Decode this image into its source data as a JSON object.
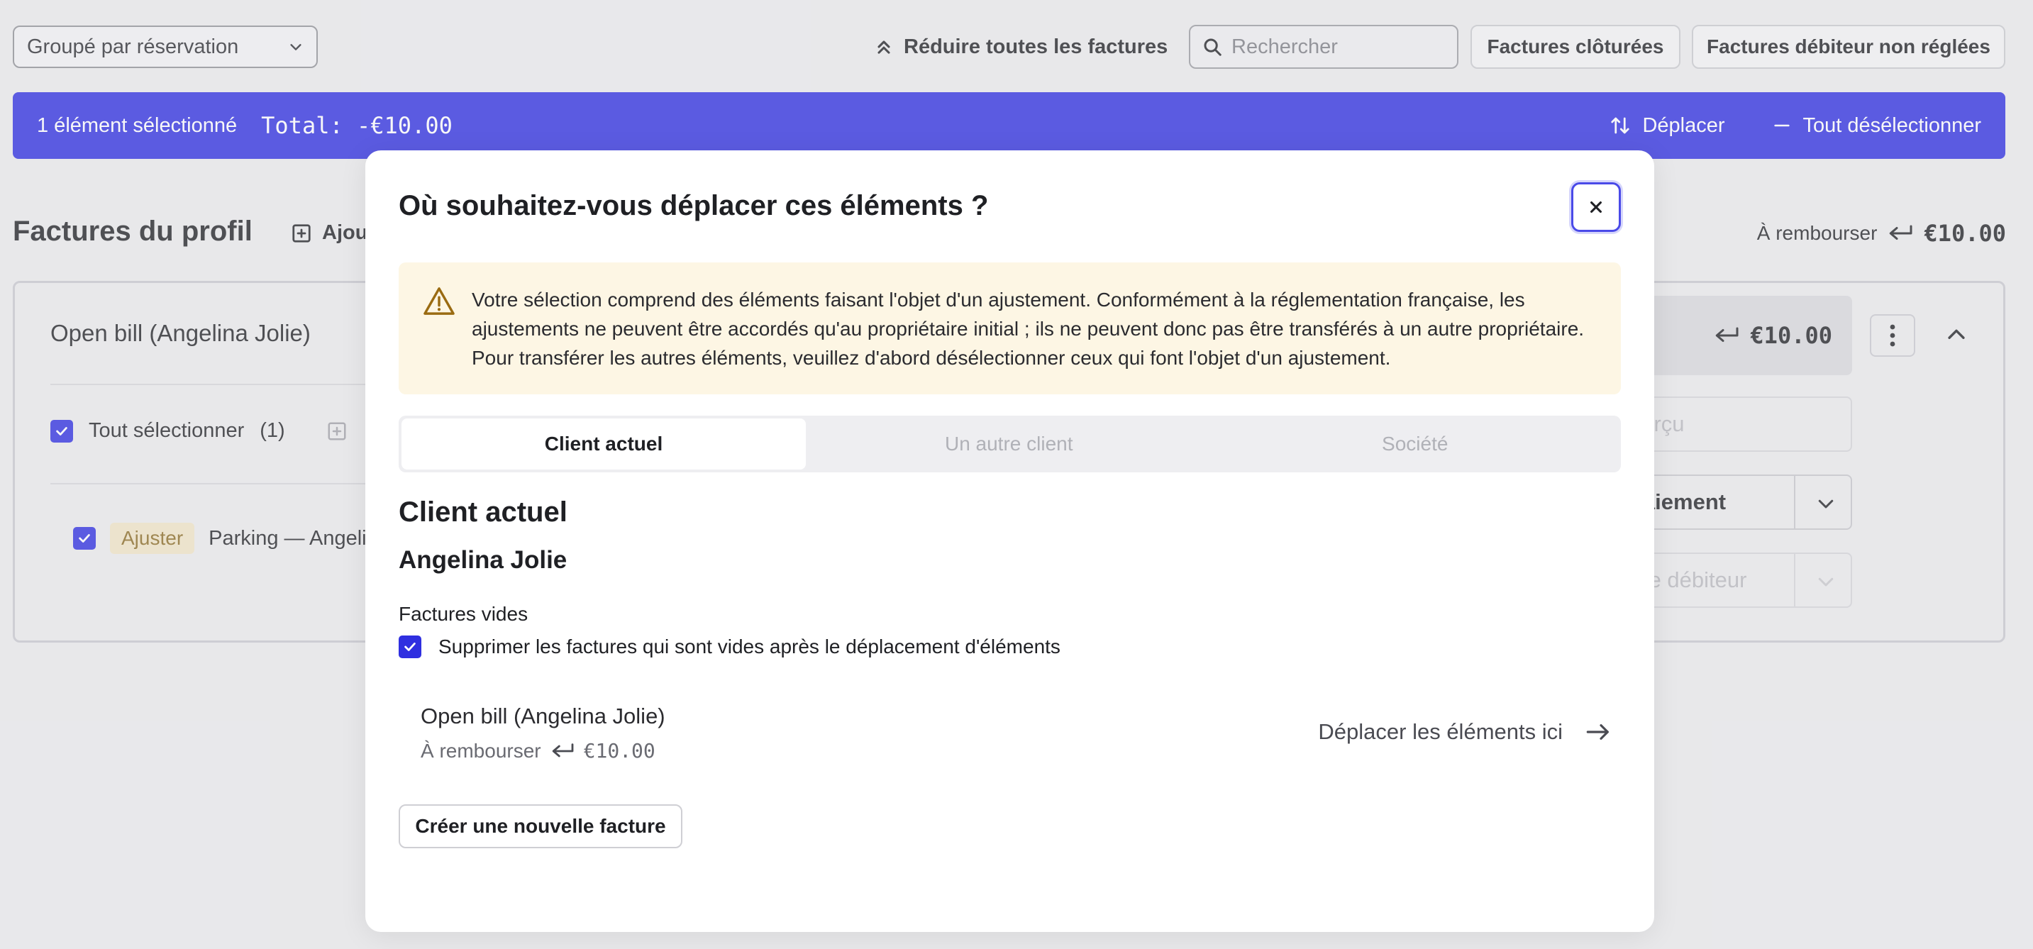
{
  "toolbar": {
    "group_select_value": "Groupé par réservation",
    "collapse_all_label": "Réduire toutes les factures",
    "search_placeholder": "Rechercher",
    "closed_bills_label": "Factures clôturées",
    "unpaid_debtor_label": "Factures débiteur non réglées"
  },
  "selection_bar": {
    "count_text": "1 élément sélectionné",
    "total_text": "Total: -€10.00",
    "move_label": "Déplacer",
    "deselect_all_label": "Tout désélectionner",
    "color": "#2f2fe0"
  },
  "profile": {
    "title": "Factures du profil",
    "add_label": "Ajou",
    "refund_label": "À rembourser",
    "refund_amount": "€10.00"
  },
  "bill_card": {
    "name": "Open bill (Angelina Jolie)",
    "select_all_label": "Tout sélectionner",
    "select_all_count": "(1)",
    "item_tag": "Ajuster",
    "item_label": "Parking — Angeli",
    "refund_amount": "€10.00",
    "preview_label": "perçu",
    "payment_label": "paiement",
    "debtor_label": "ure débiteur"
  },
  "modal": {
    "title": "Où souhaitez-vous déplacer ces éléments ?",
    "warning_text": "Votre sélection comprend des éléments faisant l'objet d'un ajustement. Conformément à la réglementation française, les ajustements ne peuvent être accordés qu'au propriétaire initial ; ils ne peuvent donc pas être transférés à un autre propriétaire. Pour transférer les autres éléments, veuillez d'abord désélectionner ceux qui font l'objet d'un ajustement.",
    "tabs": [
      {
        "label": "Client actuel",
        "active": true
      },
      {
        "label": "Un autre client",
        "active": false
      },
      {
        "label": "Société",
        "active": false
      }
    ],
    "section_title": "Client actuel",
    "client_name": "Angelina Jolie",
    "empty_bills_label": "Factures vides",
    "delete_empty_label": "Supprimer les factures qui sont vides après le déplacement d'éléments",
    "target_bill": {
      "name": "Open bill (Angelina Jolie)",
      "refund_label": "À rembourser",
      "refund_amount": "€10.00",
      "move_here_label": "Déplacer les éléments ici"
    },
    "new_bill_label": "Créer une nouvelle facture"
  }
}
